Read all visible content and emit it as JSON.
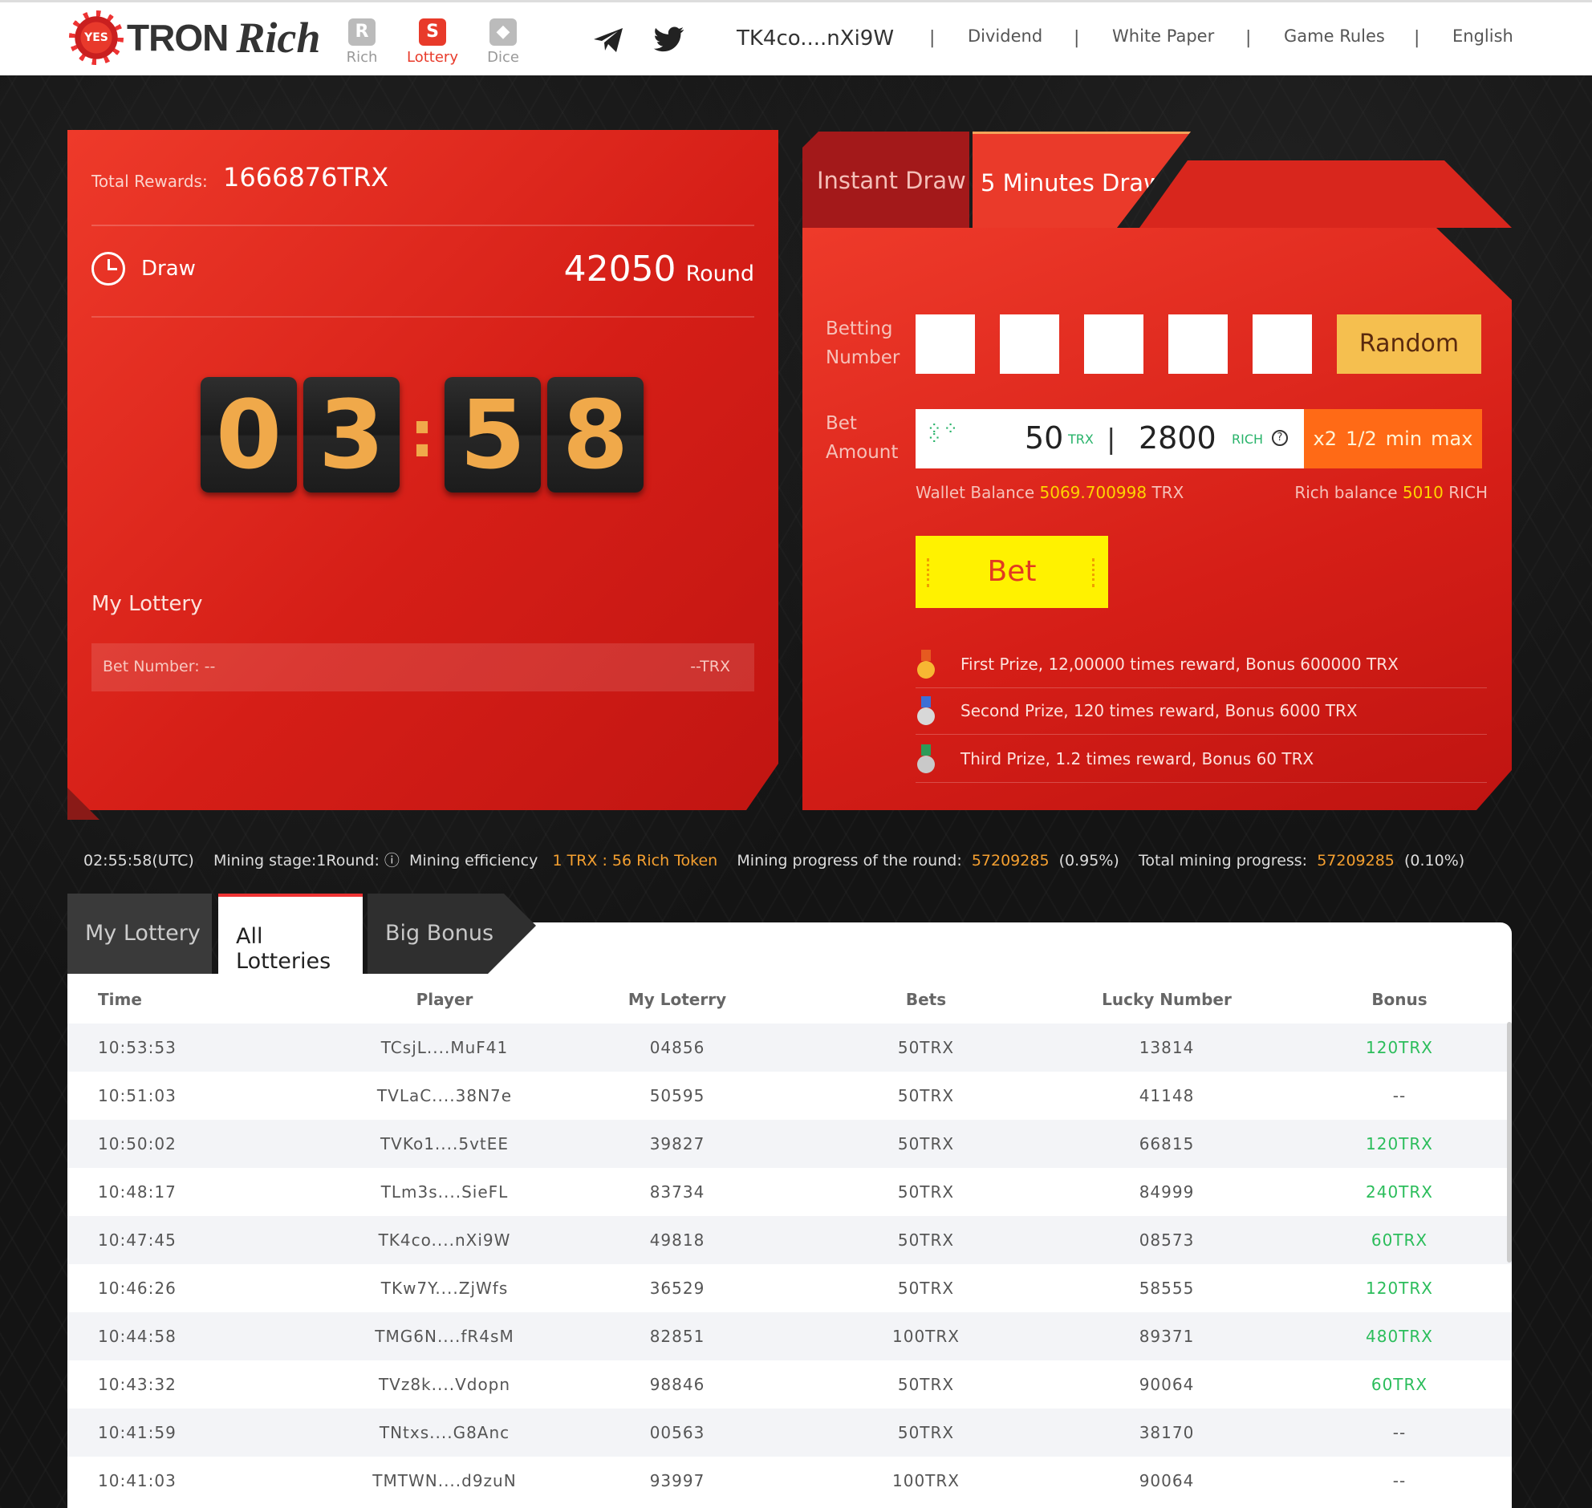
{
  "header": {
    "logo_tron": "TRON",
    "logo_rich": "Rich",
    "games": [
      {
        "label": "Rich",
        "icon": "R",
        "active": false
      },
      {
        "label": "Lottery",
        "icon": "S",
        "active": true
      },
      {
        "label": "Dice",
        "icon": "◆",
        "active": false
      }
    ],
    "address": "TK4co....nXi9W",
    "links": [
      "Dividend",
      "White Paper",
      "Game Rules",
      "English"
    ],
    "separator": "|"
  },
  "left_panel": {
    "total_rewards_label": "Total Rewards:",
    "total_rewards_value": "1666876TRX",
    "draw_label": "Draw",
    "round_number": "42050",
    "round_label": "Round",
    "timer": [
      "0",
      "3",
      ":",
      "5",
      "8"
    ],
    "my_lottery_label": "My Lottery",
    "bet_number_label": "Bet Number:  --",
    "bet_number_value": "--TRX"
  },
  "right_panel": {
    "tabs": [
      "Instant Draw",
      "5 Minutes Draw"
    ],
    "betting_number_label": [
      "Betting",
      "Number"
    ],
    "random_button": "Random",
    "bet_amount_label": [
      "Bet",
      "Amount"
    ],
    "amount_trx": "50",
    "amount_trx_unit": "TRX",
    "amount_rich": "2800",
    "amount_rich_unit": "RICH",
    "help": "?",
    "controls": [
      "x2",
      "1/2",
      "min",
      "max"
    ],
    "wallet_label": "Wallet Balance",
    "wallet_value": "5069.700998",
    "wallet_unit": "TRX",
    "rich_label": "Rich balance",
    "rich_value": "5010",
    "rich_unit": "RICH",
    "bet_button": "Bet",
    "prizes": [
      "First Prize, 12,00000 times reward, Bonus 600000 TRX",
      "Second Prize, 120 times reward, Bonus 6000 TRX",
      "Third Prize, 1.2 times reward, Bonus 60 TRX"
    ]
  },
  "mining": {
    "time": "02:55:58(UTC)",
    "stage": "Mining stage:1Round: ⓘ",
    "efficiency_label": "Mining efficiency",
    "efficiency_value": "1 TRX : 56 Rich Token",
    "round_progress_label": "Mining progress of the round:",
    "round_progress_value": "57209285",
    "round_progress_pct": "(0.95%)",
    "total_progress_label": "Total mining progress:",
    "total_progress_value": "57209285",
    "total_progress_pct": "(0.10%)"
  },
  "bottom_tabs": [
    "My Lottery",
    "All Lotteries",
    "Big Bonus"
  ],
  "table": {
    "columns": [
      "Time",
      "Player",
      "My Loterry",
      "Bets",
      "Lucky Number",
      "Bonus"
    ],
    "rows": [
      [
        "10:53:53",
        "TCsjL....MuF41",
        "04856",
        "50TRX",
        "13814",
        "120TRX"
      ],
      [
        "10:51:03",
        "TVLaC....38N7e",
        "50595",
        "50TRX",
        "41148",
        "--"
      ],
      [
        "10:50:02",
        "TVKo1....5vtEE",
        "39827",
        "50TRX",
        "66815",
        "120TRX"
      ],
      [
        "10:48:17",
        "TLm3s....SieFL",
        "83734",
        "50TRX",
        "84999",
        "240TRX"
      ],
      [
        "10:47:45",
        "TK4co....nXi9W",
        "49818",
        "50TRX",
        "08573",
        "60TRX"
      ],
      [
        "10:46:26",
        "TKw7Y....ZjWfs",
        "36529",
        "50TRX",
        "58555",
        "120TRX"
      ],
      [
        "10:44:58",
        "TMG6N....fR4sM",
        "82851",
        "100TRX",
        "89371",
        "480TRX"
      ],
      [
        "10:43:32",
        "TVz8k....Vdopn",
        "98846",
        "50TRX",
        "90064",
        "60TRX"
      ],
      [
        "10:41:59",
        "TNtxs....G8Anc",
        "00563",
        "50TRX",
        "38170",
        "--"
      ],
      [
        "10:41:03",
        "TMTWN....d9zuN",
        "93997",
        "100TRX",
        "90064",
        "--"
      ]
    ]
  }
}
